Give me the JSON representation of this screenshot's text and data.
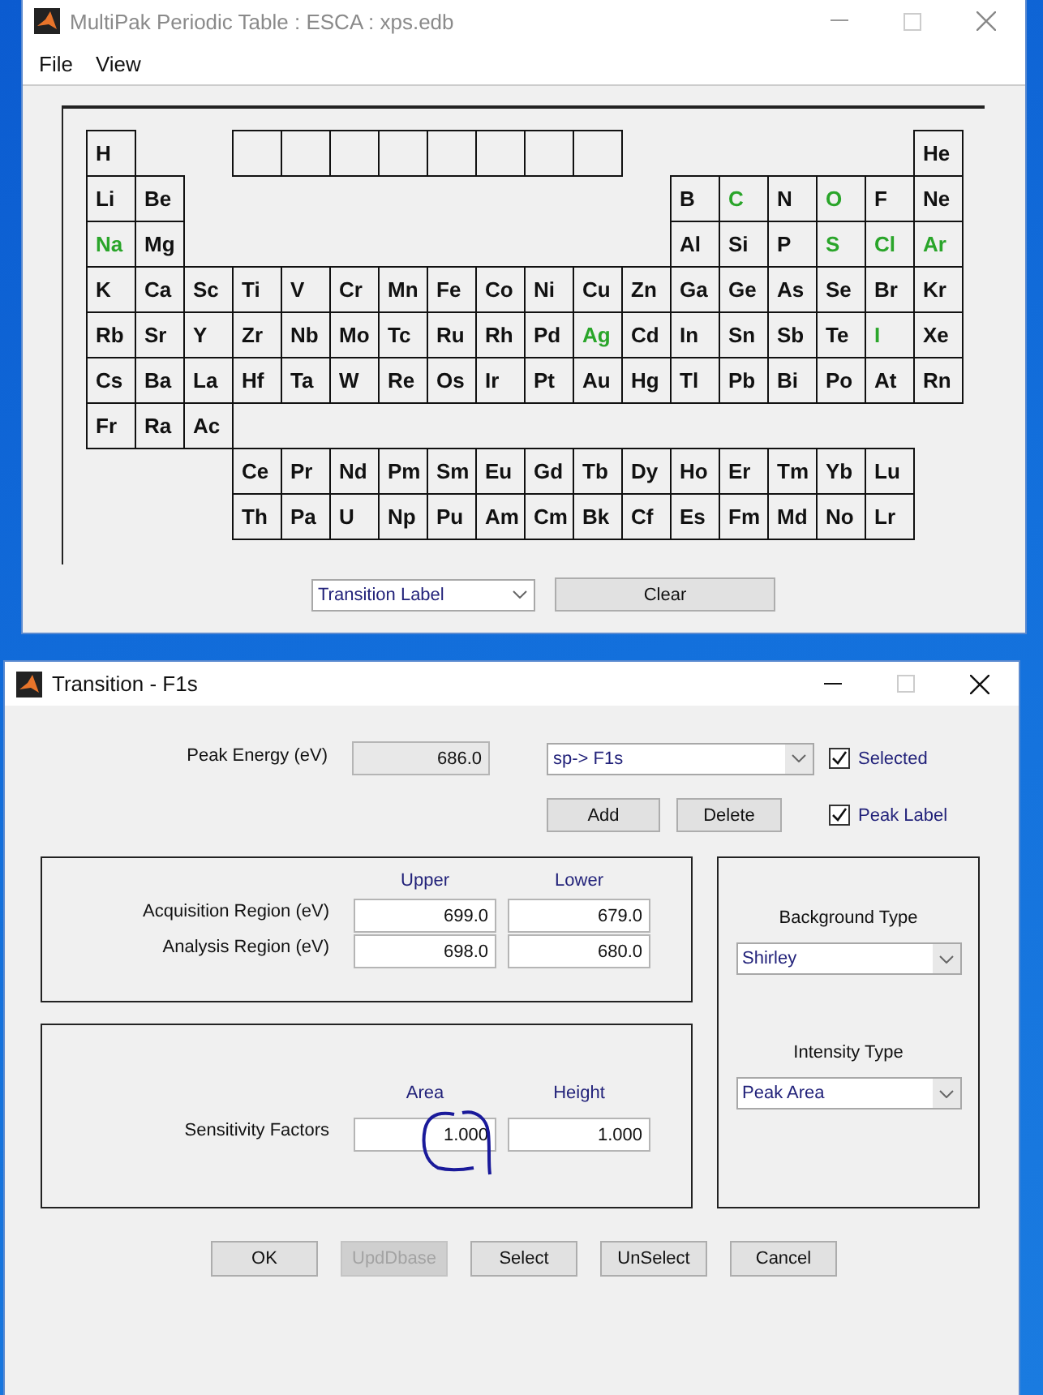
{
  "periodic_window": {
    "title": "MultiPak Periodic Table : ESCA : xps.edb",
    "menu": [
      "File",
      "View"
    ],
    "main_rows": [
      [
        {
          "symbol": "H",
          "highlighted": false
        },
        {
          "symbol": "He",
          "highlighted": false
        }
      ],
      [
        {
          "symbol": "Li",
          "highlighted": false
        },
        {
          "symbol": "Be",
          "highlighted": false
        },
        {
          "symbol": "B",
          "highlighted": false
        },
        {
          "symbol": "C",
          "highlighted": true
        },
        {
          "symbol": "N",
          "highlighted": false
        },
        {
          "symbol": "O",
          "highlighted": true
        },
        {
          "symbol": "F",
          "highlighted": false
        },
        {
          "symbol": "Ne",
          "highlighted": false
        }
      ],
      [
        {
          "symbol": "Na",
          "highlighted": true
        },
        {
          "symbol": "Mg",
          "highlighted": false
        },
        {
          "symbol": "Al",
          "highlighted": false
        },
        {
          "symbol": "Si",
          "highlighted": false
        },
        {
          "symbol": "P",
          "highlighted": false
        },
        {
          "symbol": "S",
          "highlighted": true
        },
        {
          "symbol": "Cl",
          "highlighted": true
        },
        {
          "symbol": "Ar",
          "highlighted": true
        }
      ],
      [
        {
          "symbol": "K",
          "highlighted": false
        },
        {
          "symbol": "Ca",
          "highlighted": false
        },
        {
          "symbol": "Sc",
          "highlighted": false
        },
        {
          "symbol": "Ti",
          "highlighted": false
        },
        {
          "symbol": "V",
          "highlighted": false
        },
        {
          "symbol": "Cr",
          "highlighted": false
        },
        {
          "symbol": "Mn",
          "highlighted": false
        },
        {
          "symbol": "Fe",
          "highlighted": false
        },
        {
          "symbol": "Co",
          "highlighted": false
        },
        {
          "symbol": "Ni",
          "highlighted": false
        },
        {
          "symbol": "Cu",
          "highlighted": false
        },
        {
          "symbol": "Zn",
          "highlighted": false
        },
        {
          "symbol": "Ga",
          "highlighted": false
        },
        {
          "symbol": "Ge",
          "highlighted": false
        },
        {
          "symbol": "As",
          "highlighted": false
        },
        {
          "symbol": "Se",
          "highlighted": false
        },
        {
          "symbol": "Br",
          "highlighted": false
        },
        {
          "symbol": "Kr",
          "highlighted": false
        }
      ],
      [
        {
          "symbol": "Rb",
          "highlighted": false
        },
        {
          "symbol": "Sr",
          "highlighted": false
        },
        {
          "symbol": "Y",
          "highlighted": false
        },
        {
          "symbol": "Zr",
          "highlighted": false
        },
        {
          "symbol": "Nb",
          "highlighted": false
        },
        {
          "symbol": "Mo",
          "highlighted": false
        },
        {
          "symbol": "Tc",
          "highlighted": false
        },
        {
          "symbol": "Ru",
          "highlighted": false
        },
        {
          "symbol": "Rh",
          "highlighted": false
        },
        {
          "symbol": "Pd",
          "highlighted": false
        },
        {
          "symbol": "Ag",
          "highlighted": true
        },
        {
          "symbol": "Cd",
          "highlighted": false
        },
        {
          "symbol": "In",
          "highlighted": false
        },
        {
          "symbol": "Sn",
          "highlighted": false
        },
        {
          "symbol": "Sb",
          "highlighted": false
        },
        {
          "symbol": "Te",
          "highlighted": false
        },
        {
          "symbol": "I",
          "highlighted": true
        },
        {
          "symbol": "Xe",
          "highlighted": false
        }
      ],
      [
        {
          "symbol": "Cs",
          "highlighted": false
        },
        {
          "symbol": "Ba",
          "highlighted": false
        },
        {
          "symbol": "La",
          "highlighted": false
        },
        {
          "symbol": "Hf",
          "highlighted": false
        },
        {
          "symbol": "Ta",
          "highlighted": false
        },
        {
          "symbol": "W",
          "highlighted": false
        },
        {
          "symbol": "Re",
          "highlighted": false
        },
        {
          "symbol": "Os",
          "highlighted": false
        },
        {
          "symbol": "Ir",
          "highlighted": false
        },
        {
          "symbol": "Pt",
          "highlighted": false
        },
        {
          "symbol": "Au",
          "highlighted": false
        },
        {
          "symbol": "Hg",
          "highlighted": false
        },
        {
          "symbol": "Tl",
          "highlighted": false
        },
        {
          "symbol": "Pb",
          "highlighted": false
        },
        {
          "symbol": "Bi",
          "highlighted": false
        },
        {
          "symbol": "Po",
          "highlighted": false
        },
        {
          "symbol": "At",
          "highlighted": false
        },
        {
          "symbol": "Rn",
          "highlighted": false
        }
      ],
      [
        {
          "symbol": "Fr",
          "highlighted": false
        },
        {
          "symbol": "Ra",
          "highlighted": false
        },
        {
          "symbol": "Ac",
          "highlighted": false
        }
      ]
    ],
    "f_block_rows": [
      [
        {
          "symbol": "Ce",
          "highlighted": false
        },
        {
          "symbol": "Pr",
          "highlighted": false
        },
        {
          "symbol": "Nd",
          "highlighted": false
        },
        {
          "symbol": "Pm",
          "highlighted": false
        },
        {
          "symbol": "Sm",
          "highlighted": false
        },
        {
          "symbol": "Eu",
          "highlighted": false
        },
        {
          "symbol": "Gd",
          "highlighted": false
        },
        {
          "symbol": "Tb",
          "highlighted": false
        },
        {
          "symbol": "Dy",
          "highlighted": false
        },
        {
          "symbol": "Ho",
          "highlighted": false
        },
        {
          "symbol": "Er",
          "highlighted": false
        },
        {
          "symbol": "Tm",
          "highlighted": false
        },
        {
          "symbol": "Yb",
          "highlighted": false
        },
        {
          "symbol": "Lu",
          "highlighted": false
        }
      ],
      [
        {
          "symbol": "Th",
          "highlighted": false
        },
        {
          "symbol": "Pa",
          "highlighted": false
        },
        {
          "symbol": "U",
          "highlighted": false
        },
        {
          "symbol": "Np",
          "highlighted": false
        },
        {
          "symbol": "Pu",
          "highlighted": false
        },
        {
          "symbol": "Am",
          "highlighted": false
        },
        {
          "symbol": "Cm",
          "highlighted": false
        },
        {
          "symbol": "Bk",
          "highlighted": false
        },
        {
          "symbol": "Cf",
          "highlighted": false
        },
        {
          "symbol": "Es",
          "highlighted": false
        },
        {
          "symbol": "Fm",
          "highlighted": false
        },
        {
          "symbol": "Md",
          "highlighted": false
        },
        {
          "symbol": "No",
          "highlighted": false
        },
        {
          "symbol": "Lr",
          "highlighted": false
        }
      ]
    ],
    "label_select": {
      "value": "Transition Label"
    },
    "clear_button": "Clear"
  },
  "transition_window": {
    "title": "Transition - F1s",
    "peak_energy": {
      "label": "Peak Energy (eV)",
      "value": "686.0"
    },
    "transition_select": {
      "value": "sp-> F1s"
    },
    "checkboxes": [
      {
        "label": "Selected",
        "checked": true
      },
      {
        "label": "Peak Label",
        "checked": true
      }
    ],
    "add_button": "Add",
    "delete_button": "Delete",
    "region_group": {
      "columns": [
        "Upper",
        "Lower"
      ],
      "rows": [
        {
          "label": "Acquisition Region (eV)",
          "values": [
            "699.0",
            "679.0"
          ]
        },
        {
          "label": "Analysis Region (eV)",
          "values": [
            "698.0",
            "680.0"
          ]
        }
      ]
    },
    "sensitivity_group": {
      "columns": [
        "Area",
        "Height"
      ],
      "rows": [
        {
          "label": "Sensitivity Factors",
          "values": [
            "1.000",
            "1.000"
          ]
        }
      ]
    },
    "background_type": {
      "label": "Background Type",
      "value": "Shirley"
    },
    "intensity_type": {
      "label": "Intensity Type",
      "value": "Peak Area"
    },
    "buttons": [
      {
        "label": "OK",
        "disabled": false
      },
      {
        "label": "UpdDbase",
        "disabled": true
      },
      {
        "label": "Select",
        "disabled": false
      },
      {
        "label": "UnSelect",
        "disabled": false
      },
      {
        "label": "Cancel",
        "disabled": false
      }
    ]
  }
}
